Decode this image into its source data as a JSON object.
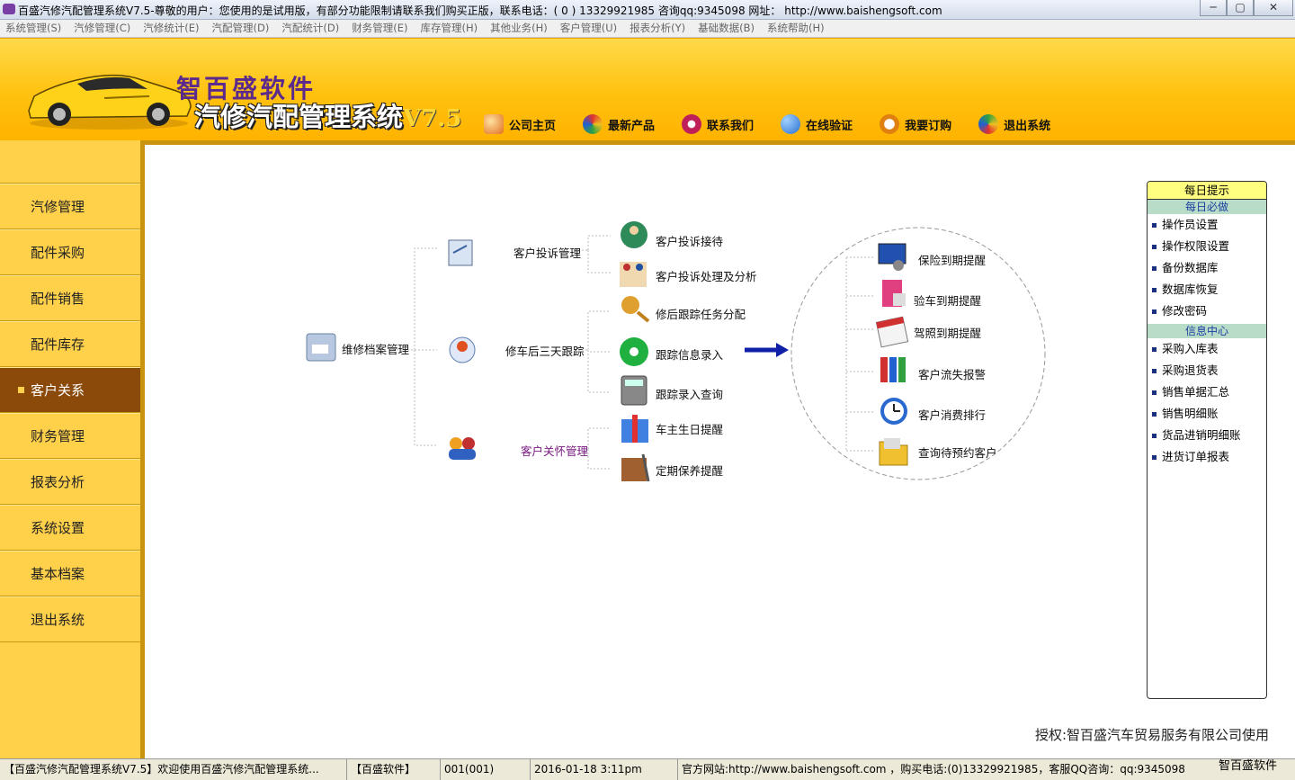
{
  "window": {
    "title": "百盛汽修汽配管理系统V7.5-尊敬的用户：您使用的是试用版，有部分功能限制请联系我们购买正版，联系电话：( 0 ) 13329921985  咨询qq:9345098    网址： http://www.baishengsoft.com",
    "minimize": "─",
    "maximize": "▢",
    "close": "✕"
  },
  "menu": [
    "系统管理(S)",
    "汽修管理(C)",
    "汽修统计(E)",
    "汽配管理(D)",
    "汽配统计(D)",
    "财务管理(E)",
    "库存管理(H)",
    "其他业务(H)",
    "客户管理(U)",
    "报表分析(Y)",
    "基础数据(B)",
    "系统帮助(H)"
  ],
  "logo": {
    "line1": "智百盛软件",
    "line2": "汽修汽配管理系统",
    "version": "V7.5"
  },
  "topnav": [
    {
      "label": "公司主页",
      "icon": "home-icon",
      "color": "#e07020"
    },
    {
      "label": "最新产品",
      "icon": "pinwheel-icon",
      "color": "#d03070"
    },
    {
      "label": "联系我们",
      "icon": "contact-icon",
      "color": "#c0205a"
    },
    {
      "label": "在线验证",
      "icon": "link-icon",
      "color": "#2a70d0"
    },
    {
      "label": "我要订购",
      "icon": "search-icon",
      "color": "#e08010"
    },
    {
      "label": "退出系统",
      "icon": "exit-icon",
      "color": "#30a040"
    }
  ],
  "sidebar": [
    "汽修管理",
    "配件采购",
    "配件销售",
    "配件库存",
    "客户关系",
    "财务管理",
    "报表分析",
    "系统设置",
    "基本档案",
    "退出系统"
  ],
  "sidebar_active": "客户关系",
  "diagram": {
    "root": "维修档案管理",
    "groups": [
      "客户投诉管理",
      "修车后三天跟踪",
      "客户关怀管理"
    ],
    "items": [
      "客户投诉接待",
      "客户投诉处理及分析",
      "修后跟踪任务分配",
      "跟踪信息录入",
      "跟踪录入查询",
      "车主生日提醒",
      "定期保养提醒"
    ],
    "reminders": [
      "保险到期提醒",
      "验车到期提醒",
      "驾照到期提醒",
      "客户流失报警",
      "客户消费排行",
      "查询待预约客户"
    ]
  },
  "panel": {
    "title": "每日提示",
    "section1": "每日必做",
    "items1": [
      "操作员设置",
      "操作权限设置",
      "备份数据库",
      "数据库恢复",
      "修改密码"
    ],
    "section2": "信息中心",
    "items2": [
      "采购入库表",
      "采购退货表",
      "销售单据汇总",
      "销售明细账",
      "货品进销明细账",
      "进货订单报表"
    ]
  },
  "authorization": "授权:智百盛汽车贸易服务有限公司使用",
  "status": {
    "s1": "【百盛汽修汽配管理系统V7.5】欢迎使用百盛汽修汽配管理系统...",
    "s2": "【百盛软件】",
    "s3": "001(001)",
    "s4": "2016-01-18 3:11pm",
    "s5": "官方网站:http://www.baishengsoft.com ，购买电话:(0)13329921985，客服QQ咨询：qq:9345098",
    "brand": "智百盛软件"
  }
}
